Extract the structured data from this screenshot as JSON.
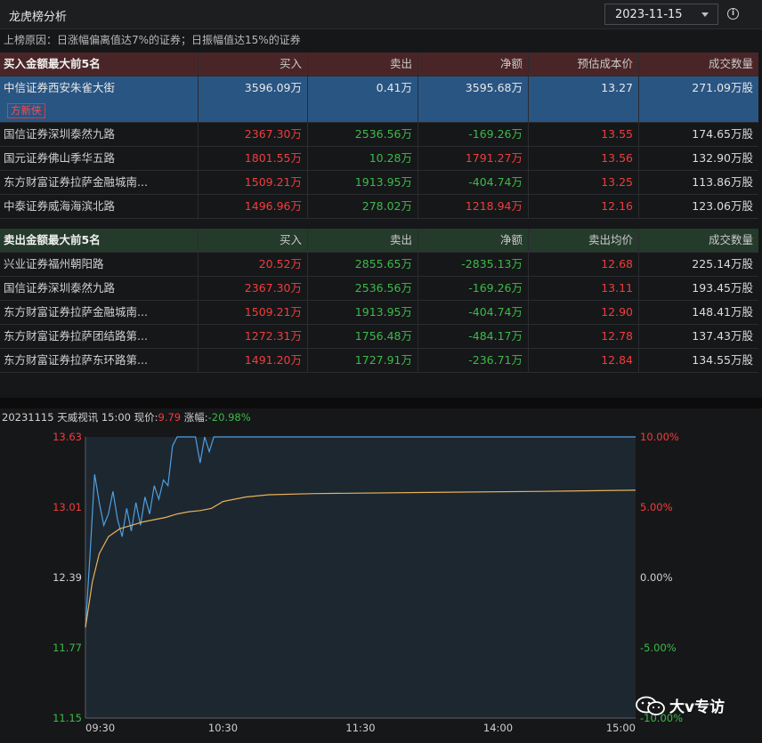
{
  "header": {
    "title": "龙虎榜分析",
    "date": "2023-11-15",
    "info_icon": "info-circle-icon"
  },
  "reason": "上榜原因：日涨幅偏离值达7%的证券；日振幅值达15%的证券",
  "buy_table": {
    "title": "买入金额最大前5名",
    "columns": [
      "买入",
      "卖出",
      "净额",
      "预估成本价",
      "成交数量"
    ],
    "rows": [
      {
        "name": "中信证券西安朱雀大街",
        "tag": "方新侠",
        "buy": "3596.09万",
        "sell": "0.41万",
        "net": "3595.68万",
        "price": "13.27",
        "volume": "271.09万股",
        "selected": true
      },
      {
        "name": "国信证券深圳泰然九路",
        "buy": "2367.30万",
        "sell": "2536.56万",
        "net": "-169.26万",
        "price": "13.55",
        "volume": "174.65万股"
      },
      {
        "name": "国元证券佛山季华五路",
        "buy": "1801.55万",
        "sell": "10.28万",
        "net": "1791.27万",
        "price": "13.56",
        "volume": "132.90万股"
      },
      {
        "name": "东方财富证券拉萨金融城南...",
        "buy": "1509.21万",
        "sell": "1913.95万",
        "net": "-404.74万",
        "price": "13.25",
        "volume": "113.86万股"
      },
      {
        "name": "中泰证券威海海滨北路",
        "buy": "1496.96万",
        "sell": "278.02万",
        "net": "1218.94万",
        "price": "12.16",
        "volume": "123.06万股"
      }
    ]
  },
  "sell_table": {
    "title": "卖出金额最大前5名",
    "columns": [
      "买入",
      "卖出",
      "净额",
      "卖出均价",
      "成交数量"
    ],
    "rows": [
      {
        "name": "兴业证券福州朝阳路",
        "buy": "20.52万",
        "sell": "2855.65万",
        "net": "-2835.13万",
        "price": "12.68",
        "volume": "225.14万股"
      },
      {
        "name": "国信证券深圳泰然九路",
        "buy": "2367.30万",
        "sell": "2536.56万",
        "net": "-169.26万",
        "price": "13.11",
        "volume": "193.45万股"
      },
      {
        "name": "东方财富证券拉萨金融城南...",
        "buy": "1509.21万",
        "sell": "1913.95万",
        "net": "-404.74万",
        "price": "12.90",
        "volume": "148.41万股"
      },
      {
        "name": "东方财富证券拉萨团结路第...",
        "buy": "1272.31万",
        "sell": "1756.48万",
        "net": "-484.17万",
        "price": "12.78",
        "volume": "137.43万股"
      },
      {
        "name": "东方财富证券拉萨东环路第...",
        "buy": "1491.20万",
        "sell": "1727.91万",
        "net": "-236.71万",
        "price": "12.84",
        "volume": "134.55万股"
      }
    ]
  },
  "chart_header": {
    "prefix": "20231115 天威视讯 15:00 现价:",
    "price": "9.79",
    "change_label": "涨幅:",
    "change": "-20.98%"
  },
  "chart_data": {
    "type": "line",
    "y_left_ticks": [
      "13.63",
      "13.01",
      "12.39",
      "11.77",
      "11.15"
    ],
    "y_right_ticks": [
      "10.00%",
      "5.00%",
      "0.00%",
      "-5.00%",
      "-10.00%"
    ],
    "x_ticks": [
      "09:30",
      "10:30",
      "11:30",
      "14:00",
      "15:00"
    ],
    "ylim": [
      11.15,
      13.63
    ],
    "x_range_minutes": [
      0,
      240
    ],
    "series": [
      {
        "color": "#4f9fe0",
        "points": [
          [
            0,
            11.95
          ],
          [
            2,
            12.6
          ],
          [
            4,
            13.3
          ],
          [
            6,
            13.05
          ],
          [
            8,
            12.85
          ],
          [
            10,
            12.95
          ],
          [
            12,
            13.15
          ],
          [
            14,
            12.9
          ],
          [
            16,
            12.75
          ],
          [
            18,
            13.0
          ],
          [
            20,
            12.8
          ],
          [
            22,
            13.05
          ],
          [
            24,
            12.85
          ],
          [
            26,
            13.1
          ],
          [
            28,
            12.95
          ],
          [
            30,
            13.2
          ],
          [
            32,
            13.08
          ],
          [
            34,
            13.25
          ],
          [
            36,
            13.2
          ],
          [
            38,
            13.55
          ],
          [
            40,
            13.63
          ],
          [
            44,
            13.63
          ],
          [
            48,
            13.63
          ],
          [
            50,
            13.4
          ],
          [
            52,
            13.63
          ],
          [
            54,
            13.5
          ],
          [
            56,
            13.63
          ],
          [
            60,
            13.63
          ],
          [
            240,
            13.63
          ]
        ]
      },
      {
        "color": "#e8b15a",
        "points": [
          [
            0,
            11.95
          ],
          [
            3,
            12.35
          ],
          [
            6,
            12.6
          ],
          [
            10,
            12.75
          ],
          [
            15,
            12.82
          ],
          [
            20,
            12.85
          ],
          [
            25,
            12.88
          ],
          [
            30,
            12.9
          ],
          [
            35,
            12.92
          ],
          [
            40,
            12.95
          ],
          [
            45,
            12.97
          ],
          [
            50,
            12.98
          ],
          [
            55,
            13.0
          ],
          [
            60,
            13.06
          ],
          [
            70,
            13.1
          ],
          [
            80,
            13.12
          ],
          [
            100,
            13.13
          ],
          [
            150,
            13.14
          ],
          [
            200,
            13.15
          ],
          [
            240,
            13.16
          ]
        ]
      }
    ],
    "pre_close": 12.39,
    "watermark": "大v专访"
  }
}
